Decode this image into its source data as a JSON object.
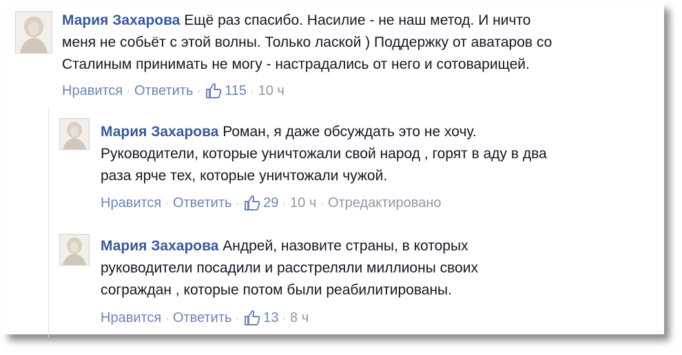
{
  "comments": [
    {
      "author": "Мария Захарова",
      "lines": [
        "Ещё раз спасибо. Насилие - не наш метод. И ничто",
        "меня не собьёт с этой волны. Только лаской ) Поддержку от аватаров со",
        "Сталиным принимать не могу - настрадались от него и сотоварищей."
      ],
      "like_label": "Нравится",
      "reply_label": "Ответить",
      "likes": "115",
      "time": "10 ч",
      "edited": ""
    },
    {
      "author": "Мария Захарова",
      "lines": [
        "Роман, я даже обсуждать это не хочу.",
        "Руководители, которые уничтожали свой народ , горят в аду в два",
        "раза ярче тех, которые уничтожали чужой."
      ],
      "like_label": "Нравится",
      "reply_label": "Ответить",
      "likes": "29",
      "time": "10 ч",
      "edited": "Отредактировано"
    },
    {
      "author": "Мария Захарова",
      "lines": [
        "Андрей, назовите страны, в которых",
        "руководители посадили и расстреляли миллионы своих",
        "сограждан , которые потом были реабилитированы."
      ],
      "like_label": "Нравится",
      "reply_label": "Ответить",
      "likes": "13",
      "time": "8 ч",
      "edited": ""
    }
  ],
  "separator": "·",
  "icons": {
    "avatar": "profile-photo",
    "like": "thumbs-up-icon"
  },
  "colors": {
    "link": "#3b5998",
    "action": "#6d84b4",
    "meta": "#9197a3",
    "text": "#141823"
  }
}
